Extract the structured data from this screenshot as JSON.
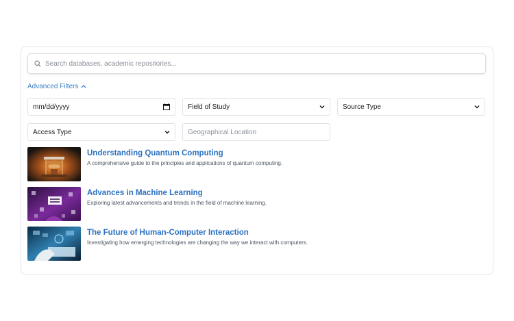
{
  "search": {
    "placeholder": "Search databases, academic repositories..."
  },
  "filters": {
    "toggle_label": "Advanced Filters",
    "expanded": true,
    "date_field": "mm/dd/yyyy",
    "field_of_study": "Field of Study",
    "source_type": "Source Type",
    "access_type": "Access Type",
    "location_placeholder": "Geographical Location"
  },
  "results": [
    {
      "title": "Understanding Quantum Computing",
      "description": "A comprehensive guide to the principles and applications of quantum computing."
    },
    {
      "title": "Advances in Machine Learning",
      "description": "Exploring latest advancements and trends in the field of machine learning."
    },
    {
      "title": "The Future of Human-Computer Interaction",
      "description": "Investigating how emerging technologies are changing the way we interact with computers."
    }
  ],
  "colors": {
    "accent": "#3b82c4",
    "title_link": "#2b72c2",
    "border": "#e3e6ea"
  }
}
